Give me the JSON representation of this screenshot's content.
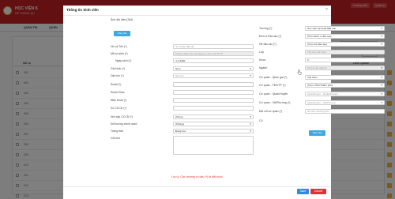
{
  "app": {
    "brand": "HỌC VIỆN K",
    "brand_sub": "HỆ THỐNG QU",
    "top_right": [
      "Hướng dẫn",
      "Quản lý"
    ],
    "user_menu": "Quản lý ▾",
    "nav": [
      "QUẢN TRỊ",
      "QUẢN"
    ],
    "table_headers": [
      "Mã cụ",
      "Loại",
      "Last Update"
    ],
    "filter_placeholder": "Quản lý cao",
    "pager_value": "10",
    "rows": [
      "001",
      "002",
      "003",
      "004",
      "005",
      "006",
      "007",
      "008",
      "009",
      "010",
      "011",
      "012",
      "013"
    ]
  },
  "modal": {
    "title": "Thông tin Sinh viên",
    "close": "×",
    "left": {
      "avatar_label": "Ảnh đại diện (3x4)",
      "avatar_button": "Chọn file",
      "ho_ten_label": "Họ và Tên (*)",
      "ho_ten_placeholder": "Họ và tên đầy đủ",
      "ma_sv_label": "Mã số sinh (*)",
      "ma_sv_placeholder": "Không nhập mã, hệ thống tự sinh mã số SV",
      "ngay_sinh_label": "Ngày sinh (*)",
      "ngay_sinh_value": "4-4-2000",
      "gioi_tinh_label": "Giới tính (*)",
      "gioi_tinh_value": "Nam",
      "dan_toc_label": "Dân tộc (*)",
      "dan_toc_value": "Dân tộc",
      "email_label": "Email (*)",
      "email2_label": "Email Khác",
      "dien_thoai_label": "Điện thoại (*)",
      "cccd_label": "Số CCCD (*)",
      "noi_cap_label": "Nơi cấp CCCD (*)",
      "noi_cap_value": "(Chọn)",
      "doi_tuong_label": "Đối tượng chính sách",
      "doi_tuong_value": "(Không)",
      "trang_thai_label": "Trạng thái",
      "trang_thai_value": "Đang học",
      "ghi_chu_label": "Ghi chú"
    },
    "right": {
      "truong_label": "Trường (*)",
      "truong_value": "Học viện Kỹ thuật Mật mã",
      "don_vi_label": "Đơn vị Đào tạo (*)",
      "don_vi_value": "(Chọn Đơn vị đào tạo)",
      "he_dao_tao_label": "Hệ đào tạo (*)",
      "he_dao_tao_value": "(Chọn hệ đào tạo)",
      "lop_label": "Lớp",
      "lop_placeholder": "Tên lớp sinh viên",
      "khoa_label": "Khoá",
      "khoa_value": "0",
      "nganh_label": "Ngành",
      "nganh_value": "(Chọn các ngành)",
      "quoc_gia_label": "Cơ quan - Quốc gia (*)",
      "quoc_gia_value": "Việt Nam",
      "tinh_label": "Cơ quan - Tỉnh/TP (*)",
      "tinh_value": "(Chọn Tỉnh/Thành phố)",
      "huyen_label": "Cơ quan - Quận/Huyện",
      "huyen_value": "Quận/huyện - (Quận/Huyện)",
      "xa_label": "Cơ quan - Xã/Phường (*)",
      "xa_value": "Quận/huyện - Xã/Phường",
      "dia_chi_label": "Địa chỉ cơ quan (*)",
      "dia_chi_placeholder": "Số nhà, đường phố...",
      "cv_label": "CV",
      "cv_button": "Chọn file"
    },
    "note": "Lưu ý: Các trường có dấu (*) là bắt buộc",
    "save": "Save",
    "cancel": "Cancel"
  },
  "colors": {
    "header_red": "#c42125",
    "primary_blue": "#2f8dd6",
    "danger_red": "#d9343a"
  }
}
